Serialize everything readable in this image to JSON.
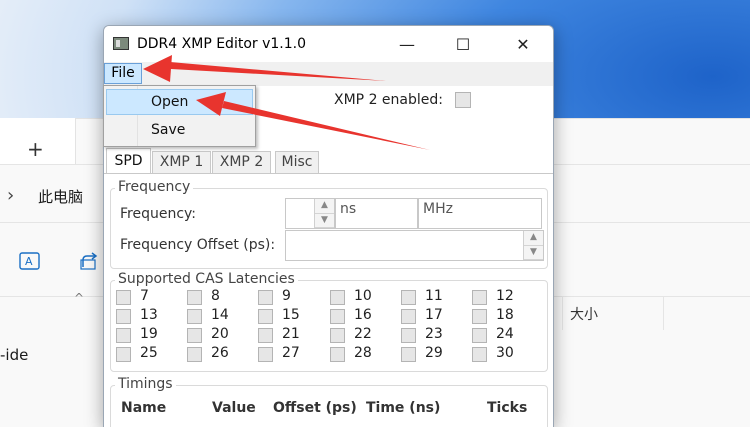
{
  "explorer": {
    "new_tab": "+",
    "nav_chevron": "›",
    "breadcrumb": "此电脑",
    "column_size": "大小",
    "file_row": "-ide"
  },
  "window": {
    "title": "DDR4 XMP Editor v1.1.0",
    "minimize": "—",
    "maximize": "☐",
    "close": "✕",
    "menu": {
      "file": "File"
    },
    "file_menu": {
      "items": [
        "Open",
        "Save"
      ]
    },
    "xmp2_enabled_label": "XMP 2 enabled:",
    "tabs": [
      "SPD",
      "XMP 1",
      "XMP 2",
      "Misc"
    ],
    "frequency_group": {
      "title": "Frequency",
      "frequency_label": "Frequency:",
      "unit_ns": "ns",
      "unit_mhz": "MHz",
      "offset_label": "Frequency Offset (ps):"
    },
    "cas_group": {
      "title": "Supported CAS Latencies",
      "latencies": [
        "7",
        "8",
        "9",
        "10",
        "11",
        "12",
        "13",
        "14",
        "15",
        "16",
        "17",
        "18",
        "19",
        "20",
        "21",
        "22",
        "23",
        "24",
        "25",
        "26",
        "27",
        "28",
        "29",
        "30"
      ]
    },
    "timings_group": {
      "title": "Timings",
      "headers": [
        "Name",
        "Value",
        "Offset (ps)",
        "Time (ns)",
        "Ticks"
      ]
    }
  },
  "colors": {
    "menu_highlight": "#cce8ff",
    "arrow": "#e8342e",
    "wallpaper_blue": "#1e63c9"
  }
}
